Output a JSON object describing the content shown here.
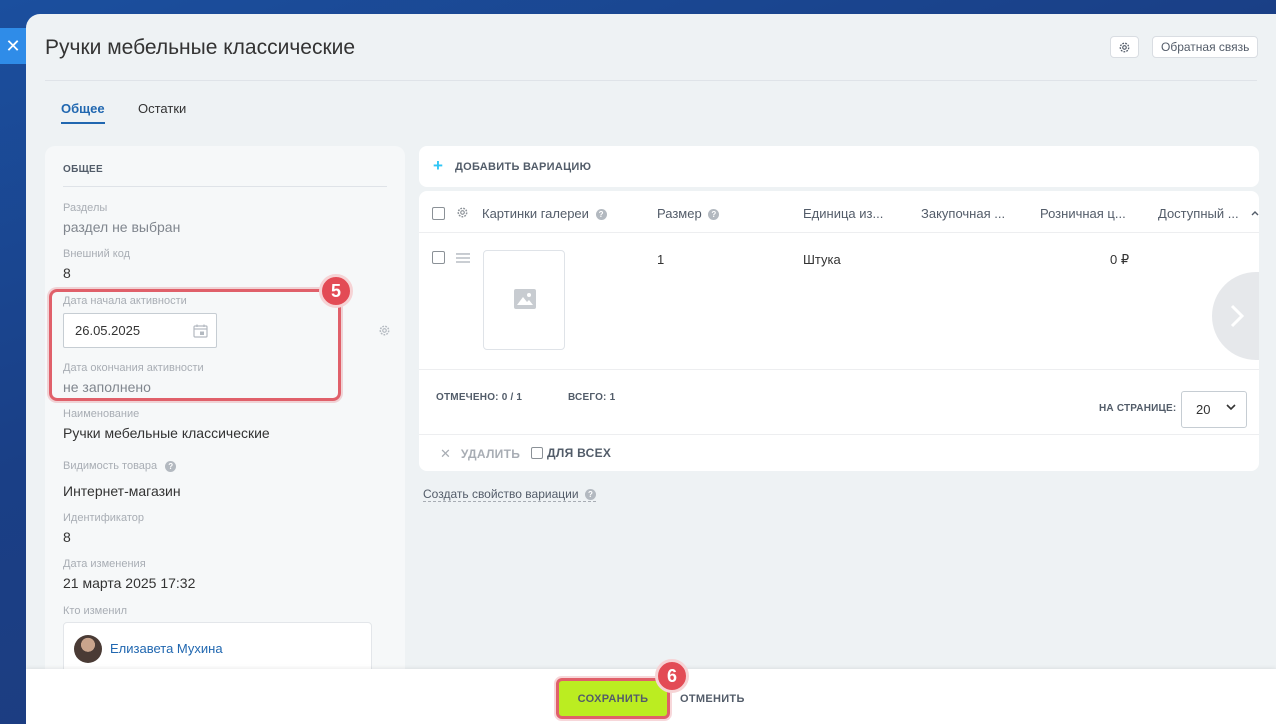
{
  "window": {
    "close_icon": "close-icon",
    "title": "Ручки мебельные классические"
  },
  "header": {
    "feedback_label": "Обратная связь",
    "settings_icon": "gear-icon"
  },
  "tabs": [
    {
      "label": "Общее",
      "active": true
    },
    {
      "label": "Остатки",
      "active": false
    }
  ],
  "left": {
    "section_title": "ОБЩЕЕ",
    "fields": {
      "sections_label": "Разделы",
      "sections_value": "раздел не выбран",
      "extcode_label": "Внешний код",
      "extcode_value": "8",
      "date_start_label": "Дата начала активности",
      "date_start_value": "26.05.2025",
      "date_end_label": "Дата окончания активности",
      "date_end_value": "не заполнено",
      "name_label": "Наименование",
      "name_value": "Ручки мебельные классические",
      "visibility_label": "Видимость товара",
      "visibility_value": "Интернет-магазин",
      "id_label": "Идентификатор",
      "id_value": "8",
      "modified_label": "Дата изменения",
      "modified_value": "21 марта 2025 17:32",
      "modified_by_label": "Кто изменил",
      "modified_by_value": "Елизавета Мухина"
    },
    "step_badge": "5"
  },
  "variations": {
    "add_label": "ДОБАВИТЬ ВАРИАЦИЮ",
    "columns": [
      "Картинки галереи",
      "Размер",
      "Единица из...",
      "Закупочная ...",
      "Розничная ц...",
      "Доступный ..."
    ],
    "rows": [
      {
        "size": "1",
        "unit": "Штука",
        "price": "0 ₽"
      }
    ],
    "marked_label": "ОТМЕЧЕНО:",
    "marked_value": "0 / 1",
    "total_label": "ВСЕГО:",
    "total_value": "1",
    "per_page_label": "НА СТРАНИЦЕ:",
    "per_page_value": "20",
    "delete_label": "УДАЛИТЬ",
    "for_all_label": "ДЛЯ ВСЕХ",
    "create_property": "Создать свойство вариации"
  },
  "footer": {
    "save_label": "СОХРАНИТЬ",
    "cancel_label": "ОТМЕНИТЬ",
    "step_badge": "6"
  },
  "colors": {
    "accent": "#2067b0",
    "save": "#bbed21",
    "highlight": "#e0606a"
  }
}
